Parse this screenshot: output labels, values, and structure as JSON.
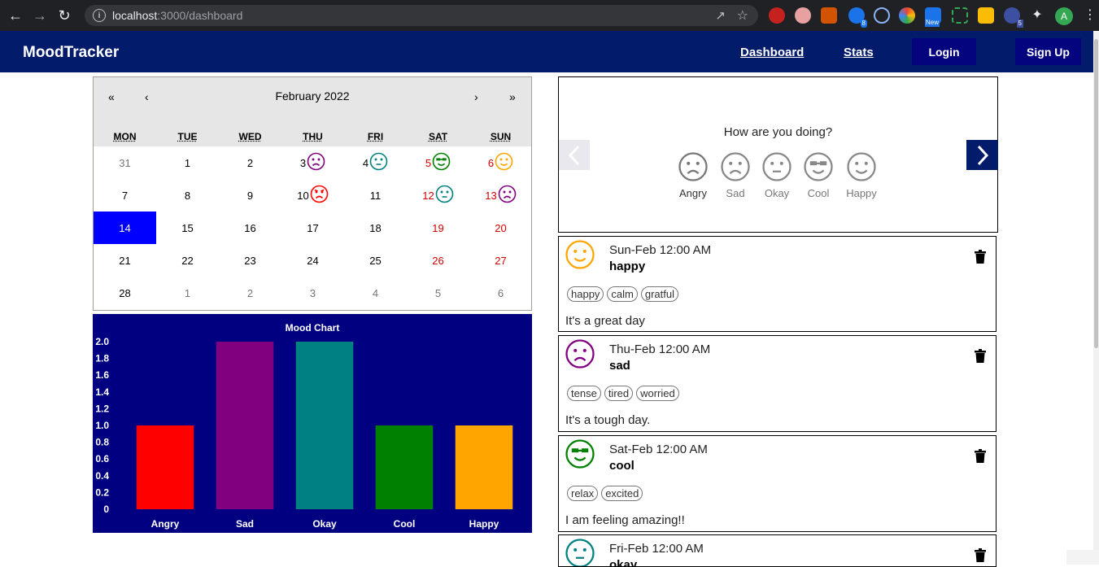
{
  "browser": {
    "url_host": "localhost",
    "url_rest": ":3000/dashboard",
    "profile_initial": "A",
    "ext_badge_1": "8",
    "ext_badge_new": "New",
    "ext_badge_5": "5"
  },
  "navbar": {
    "brand": "MoodTracker",
    "links": [
      "Dashboard",
      "Stats"
    ],
    "login": "Login",
    "signup": "Sign Up"
  },
  "calendar": {
    "prev2": "«",
    "prev": "‹",
    "label": "February 2022",
    "next": "›",
    "next2": "»",
    "weekdays": [
      "MON",
      "TUE",
      "WED",
      "THU",
      "FRI",
      "SAT",
      "SUN"
    ],
    "weeks": [
      [
        "31",
        "1",
        "2",
        "3",
        "4",
        "5",
        "6"
      ],
      [
        "7",
        "8",
        "9",
        "10",
        "11",
        "12",
        "13"
      ],
      [
        "14",
        "15",
        "16",
        "17",
        "18",
        "19",
        "20"
      ],
      [
        "21",
        "22",
        "23",
        "24",
        "25",
        "26",
        "27"
      ],
      [
        "28",
        "1",
        "2",
        "3",
        "4",
        "5",
        "6"
      ]
    ],
    "mood_days": {
      "3": "sad",
      "4": "okay",
      "5": "cool",
      "6": "happy",
      "10": "angry",
      "12": "okay",
      "13": "sad"
    },
    "today": "14"
  },
  "mood_colors": {
    "angry": "#ff0000",
    "sad": "#800080",
    "okay": "#008080",
    "cool": "#008000",
    "happy": "#ffa500"
  },
  "chart_data": {
    "type": "bar",
    "title": "Mood Chart",
    "categories": [
      "Angry",
      "Sad",
      "Okay",
      "Cool",
      "Happy"
    ],
    "values": [
      1,
      2,
      2,
      1,
      1
    ],
    "colors": [
      "#ff0000",
      "#800080",
      "#008080",
      "#008000",
      "#ffa500"
    ],
    "yticks": [
      "2.0",
      "1.8",
      "1.6",
      "1.4",
      "1.2",
      "1.0",
      "0.8",
      "0.6",
      "0.4",
      "0.2",
      "0"
    ],
    "ylim": [
      0,
      2
    ],
    "background": "#000080"
  },
  "picker": {
    "question": "How are you doing?",
    "options": [
      "Angry",
      "Sad",
      "Okay",
      "Cool",
      "Happy"
    ]
  },
  "entries": [
    {
      "date": "Sun-Feb 12:00 AM",
      "mood": "happy",
      "tags": [
        "happy",
        "calm",
        "gratful"
      ],
      "note": "It's a great day"
    },
    {
      "date": "Thu-Feb 12:00 AM",
      "mood": "sad",
      "tags": [
        "tense",
        "tired",
        "worried"
      ],
      "note": "It's a tough day."
    },
    {
      "date": "Sat-Feb 12:00 AM",
      "mood": "cool",
      "tags": [
        "relax",
        "excited"
      ],
      "note": "I am feeling amazing!!"
    },
    {
      "date": "Fri-Feb 12:00 AM",
      "mood": "okay",
      "tags": [],
      "note": ""
    }
  ]
}
